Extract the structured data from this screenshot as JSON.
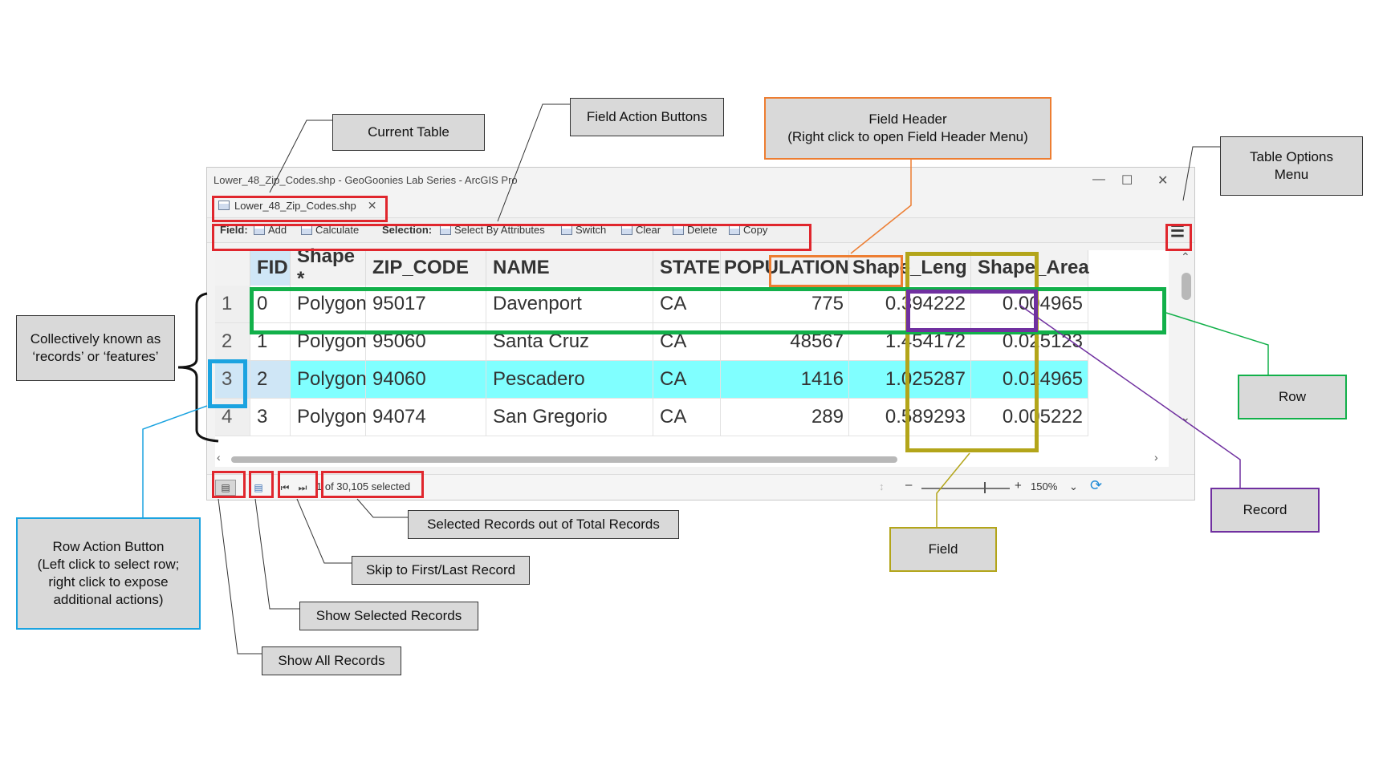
{
  "window": {
    "title": "Lower_48_Zip_Codes.shp - GeoGoonies Lab Series - ArcGIS Pro",
    "tab_label": "Lower_48_Zip_Codes.shp"
  },
  "toolbar": {
    "field_label": "Field:",
    "add": "Add",
    "calculate": "Calculate",
    "selection_label": "Selection:",
    "select_by_attributes": "Select By Attributes",
    "switch": "Switch",
    "clear": "Clear",
    "delete": "Delete",
    "copy": "Copy"
  },
  "table": {
    "columns": [
      "FID",
      "Shape *",
      "ZIP_CODE",
      "NAME",
      "STATE",
      "POPULATION",
      "Shape_Leng",
      "Shape_Area"
    ],
    "rows": [
      {
        "num": "1",
        "cells": [
          "0",
          "Polygon",
          "95017",
          "Davenport",
          "CA",
          "775",
          "0.394222",
          "0.004965"
        ]
      },
      {
        "num": "2",
        "cells": [
          "1",
          "Polygon",
          "95060",
          "Santa Cruz",
          "CA",
          "48567",
          "1.454172",
          "0.025123"
        ]
      },
      {
        "num": "3",
        "cells": [
          "2",
          "Polygon",
          "94060",
          "Pescadero",
          "CA",
          "1416",
          "1.025287",
          "0.014965"
        ],
        "selected": true
      },
      {
        "num": "4",
        "cells": [
          "3",
          "Polygon",
          "94074",
          "San Gregorio",
          "CA",
          "289",
          "0.589293",
          "0.005222"
        ]
      }
    ]
  },
  "status": {
    "selection_text": "1 of 30,105 selected",
    "zoom": "150%"
  },
  "callouts": {
    "current_table": "Current Table",
    "field_action_buttons": "Field Action Buttons",
    "field_header": "Field Header\n(Right click to open Field Header Menu)",
    "table_options_menu": "Table Options\nMenu",
    "records_features": "Collectively known as\n‘records’ or ‘features’",
    "row": "Row",
    "record": "Record",
    "field": "Field",
    "row_action_button": "Row Action Button\n(Left click to select row;\nright click to expose\nadditional actions)",
    "selected_records": "Selected Records out of Total Records",
    "skip_first_last": "Skip to First/Last Record",
    "show_selected": "Show Selected Records",
    "show_all": "Show All Records"
  },
  "colors": {
    "highlight_red": "#e0262d",
    "orange": "#ed7d31",
    "green": "#12b04a",
    "purple": "#7030a0",
    "olive": "#b3a51a",
    "blue": "#1ba3e0",
    "selected_row": "#80ffff"
  }
}
